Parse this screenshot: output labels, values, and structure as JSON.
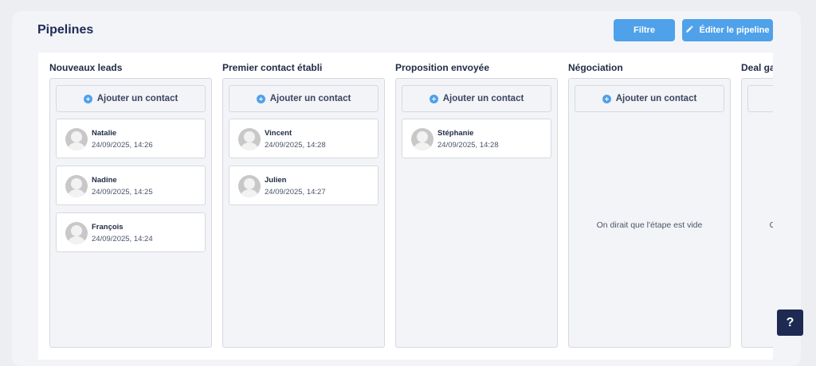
{
  "header": {
    "title": "Pipelines",
    "filter_label": "Filtre",
    "edit_label": "Éditer le pipeline"
  },
  "labels": {
    "add_contact": "Ajouter un contact",
    "empty_stage": "On dirait que l'étape est vide"
  },
  "columns": [
    {
      "title": "Nouveaux leads",
      "contacts": [
        {
          "name": "Natalie",
          "date": "24/09/2025, 14:26"
        },
        {
          "name": "Nadine",
          "date": "24/09/2025, 14:25"
        },
        {
          "name": "François",
          "date": "24/09/2025, 14:24"
        }
      ]
    },
    {
      "title": "Premier contact établi",
      "contacts": [
        {
          "name": "Vincent",
          "date": "24/09/2025, 14:28"
        },
        {
          "name": "Julien",
          "date": "24/09/2025, 14:27"
        }
      ]
    },
    {
      "title": "Proposition envoyée",
      "contacts": [
        {
          "name": "Stéphanie",
          "date": "24/09/2025, 14:28"
        }
      ]
    },
    {
      "title": "Négociation",
      "contacts": []
    },
    {
      "title": "Deal gagné",
      "contacts": []
    }
  ],
  "help_label": "?",
  "colors": {
    "accent": "#4fa1ea",
    "help_button": "#1e2a52"
  },
  "icons": {
    "edit": "pencil-icon",
    "add": "plus-circle-icon",
    "avatar": "user-avatar-icon"
  }
}
